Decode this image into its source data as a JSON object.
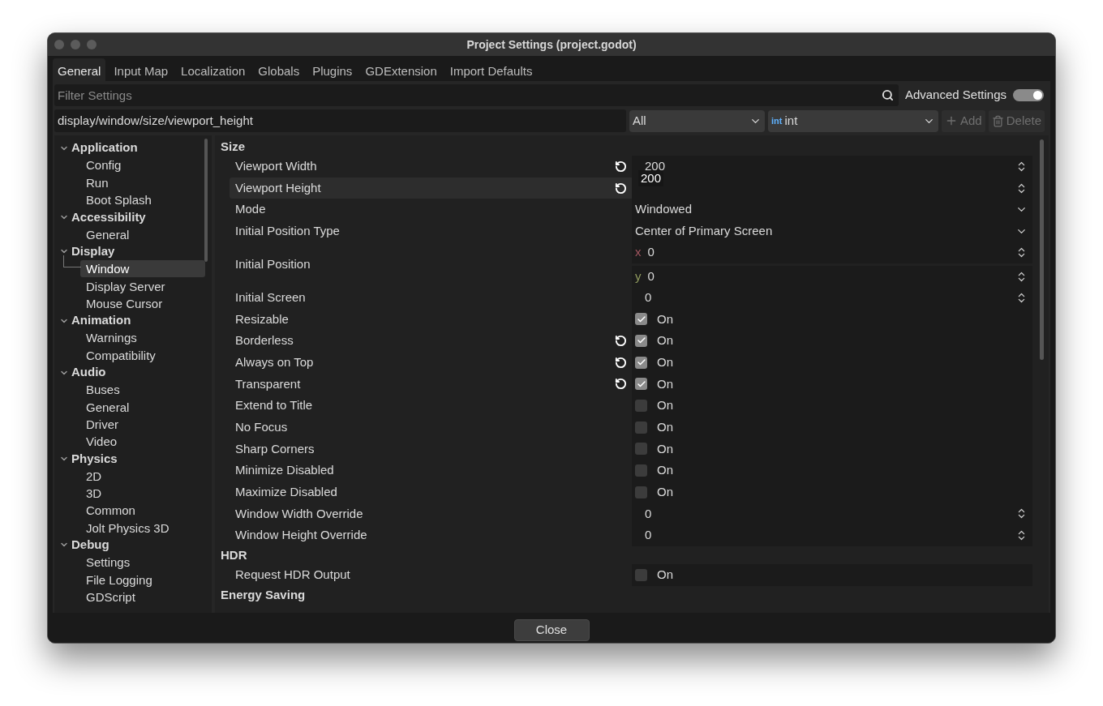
{
  "window": {
    "title": "Project Settings (project.godot)"
  },
  "tabs": [
    {
      "label": "General",
      "selected": true
    },
    {
      "label": "Input Map",
      "selected": false
    },
    {
      "label": "Localization",
      "selected": false
    },
    {
      "label": "Globals",
      "selected": false
    },
    {
      "label": "Plugins",
      "selected": false
    },
    {
      "label": "GDExtension",
      "selected": false
    },
    {
      "label": "Import Defaults",
      "selected": false
    }
  ],
  "filter": {
    "placeholder": "Filter Settings"
  },
  "advanced_settings": {
    "label": "Advanced Settings",
    "on": true
  },
  "property_path": {
    "value": "display/window/size/viewport_height"
  },
  "scope_select": {
    "value": "All"
  },
  "type_select": {
    "badge": "int",
    "value": "int"
  },
  "add_button": {
    "label": "Add",
    "disabled": true
  },
  "delete_button": {
    "label": "Delete",
    "disabled": true
  },
  "sidebar": {
    "items": [
      {
        "label": "Application",
        "expanded": true,
        "selected": false,
        "children": [
          {
            "label": "Config",
            "selected": false
          },
          {
            "label": "Run",
            "selected": false
          },
          {
            "label": "Boot Splash",
            "selected": false
          }
        ]
      },
      {
        "label": "Accessibility",
        "expanded": true,
        "selected": false,
        "children": [
          {
            "label": "General",
            "selected": false
          }
        ]
      },
      {
        "label": "Display",
        "expanded": true,
        "selected": false,
        "children": [
          {
            "label": "Window",
            "selected": true
          },
          {
            "label": "Display Server",
            "selected": false
          },
          {
            "label": "Mouse Cursor",
            "selected": false
          }
        ]
      },
      {
        "label": "Animation",
        "expanded": true,
        "selected": false,
        "children": [
          {
            "label": "Warnings",
            "selected": false
          },
          {
            "label": "Compatibility",
            "selected": false
          }
        ]
      },
      {
        "label": "Audio",
        "expanded": true,
        "selected": false,
        "children": [
          {
            "label": "Buses",
            "selected": false
          },
          {
            "label": "General",
            "selected": false
          },
          {
            "label": "Driver",
            "selected": false
          },
          {
            "label": "Video",
            "selected": false
          }
        ]
      },
      {
        "label": "Physics",
        "expanded": true,
        "selected": false,
        "children": [
          {
            "label": "2D",
            "selected": false
          },
          {
            "label": "3D",
            "selected": false
          },
          {
            "label": "Common",
            "selected": false
          },
          {
            "label": "Jolt Physics 3D",
            "selected": false
          }
        ]
      },
      {
        "label": "Debug",
        "expanded": true,
        "selected": false,
        "children": [
          {
            "label": "Settings",
            "selected": false
          },
          {
            "label": "File Logging",
            "selected": false
          },
          {
            "label": "GDScript",
            "selected": false
          }
        ]
      }
    ]
  },
  "sections": [
    {
      "title": "Size",
      "rows": [
        {
          "kind": "number",
          "label": "Viewport Width",
          "value": "200",
          "revert": true,
          "selected": false
        },
        {
          "kind": "number",
          "label": "Viewport Height",
          "tooltip": "200",
          "revert": true,
          "selected": true
        },
        {
          "kind": "select",
          "label": "Mode",
          "value": "Windowed",
          "revert": false,
          "selected": false
        },
        {
          "kind": "select",
          "label": "Initial Position Type",
          "value": "Center of Primary Screen",
          "revert": false,
          "selected": false
        },
        {
          "kind": "vector",
          "label": "Initial Position",
          "revert": false,
          "selected": false,
          "components": [
            {
              "axis": "x",
              "value": "0",
              "color": "#a0555f"
            },
            {
              "axis": "y",
              "value": "0",
              "color": "#8f9a5e"
            }
          ]
        },
        {
          "kind": "number",
          "label": "Initial Screen",
          "value": "0",
          "revert": false,
          "selected": false
        },
        {
          "kind": "check",
          "label": "Resizable",
          "checked": true,
          "text": "On",
          "revert": false,
          "selected": false
        },
        {
          "kind": "check",
          "label": "Borderless",
          "checked": true,
          "text": "On",
          "revert": true,
          "selected": false
        },
        {
          "kind": "check",
          "label": "Always on Top",
          "checked": true,
          "text": "On",
          "revert": true,
          "selected": false
        },
        {
          "kind": "check",
          "label": "Transparent",
          "checked": true,
          "text": "On",
          "revert": true,
          "selected": false
        },
        {
          "kind": "check",
          "label": "Extend to Title",
          "checked": false,
          "text": "On",
          "revert": false,
          "selected": false
        },
        {
          "kind": "check",
          "label": "No Focus",
          "checked": false,
          "text": "On",
          "revert": false,
          "selected": false
        },
        {
          "kind": "check",
          "label": "Sharp Corners",
          "checked": false,
          "text": "On",
          "revert": false,
          "selected": false
        },
        {
          "kind": "check",
          "label": "Minimize Disabled",
          "checked": false,
          "text": "On",
          "revert": false,
          "selected": false
        },
        {
          "kind": "check",
          "label": "Maximize Disabled",
          "checked": false,
          "text": "On",
          "revert": false,
          "selected": false
        },
        {
          "kind": "number",
          "label": "Window Width Override",
          "value": "0",
          "revert": false,
          "selected": false
        },
        {
          "kind": "number",
          "label": "Window Height Override",
          "value": "0",
          "revert": false,
          "selected": false
        }
      ]
    },
    {
      "title": "HDR",
      "rows": [
        {
          "kind": "check",
          "label": "Request HDR Output",
          "checked": false,
          "text": "On",
          "revert": false,
          "selected": false
        }
      ]
    },
    {
      "title": "Energy Saving"
    }
  ],
  "close_button": {
    "label": "Close"
  }
}
